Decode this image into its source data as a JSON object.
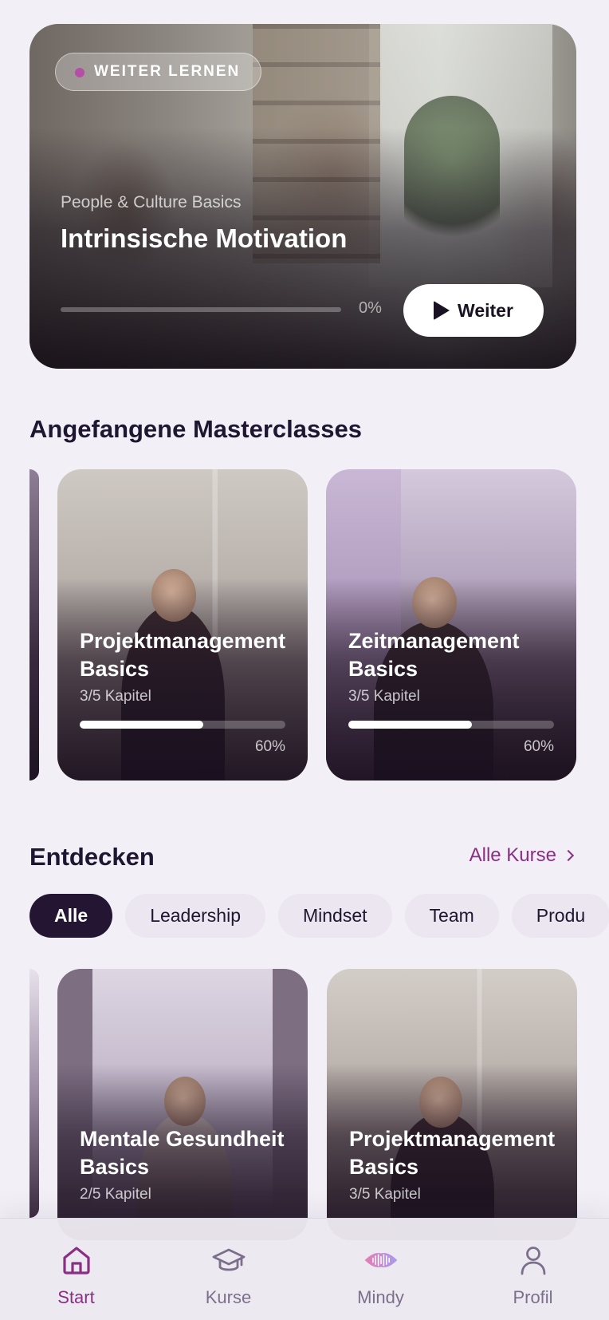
{
  "hero": {
    "badge": "WEITER LERNEN",
    "category": "People & Culture Basics",
    "title": "Intrinsische Motivation",
    "progress_label": "0%",
    "progress": 0,
    "button_label": "Weiter"
  },
  "started": {
    "title": "Angefangene Masterclasses",
    "cards": [
      {
        "title": "Projektmanagement Basics",
        "title_line1": "Projektmanagement",
        "title_line2": "Basics",
        "chapters": "3/5 Kapitel",
        "progress_label": "60%",
        "progress": 0.6
      },
      {
        "title": "Zeitmanagement Basics",
        "title_line1": "Zeitmanagement",
        "title_line2": "Basics",
        "chapters": "3/5 Kapitel",
        "progress_label": "60%",
        "progress": 0.6
      }
    ]
  },
  "discover": {
    "title": "Entdecken",
    "all_courses_label": "Alle Kurse",
    "filters": [
      "Alle",
      "Leadership",
      "Mindset",
      "Team",
      "Produ"
    ],
    "active_filter": "Alle",
    "cards": [
      {
        "title_line1": "Mentale Gesundheit",
        "title_line2": "Basics",
        "chapters": "2/5 Kapitel"
      },
      {
        "title_line1": "Projektmanagement",
        "title_line2": "Basics",
        "chapters": "3/5 Kapitel"
      }
    ]
  },
  "nav": {
    "items": [
      {
        "label": "Start",
        "icon": "home-icon",
        "active": true
      },
      {
        "label": "Kurse",
        "icon": "graduation-cap-icon",
        "active": false
      },
      {
        "label": "Mindy",
        "icon": "mindy-waveform-icon",
        "active": false
      },
      {
        "label": "Profil",
        "icon": "profile-icon",
        "active": false
      }
    ]
  },
  "colors": {
    "background": "#f2eff6",
    "accent": "#8b2f84",
    "chip_active": "#241633",
    "text": "#1f1631"
  }
}
